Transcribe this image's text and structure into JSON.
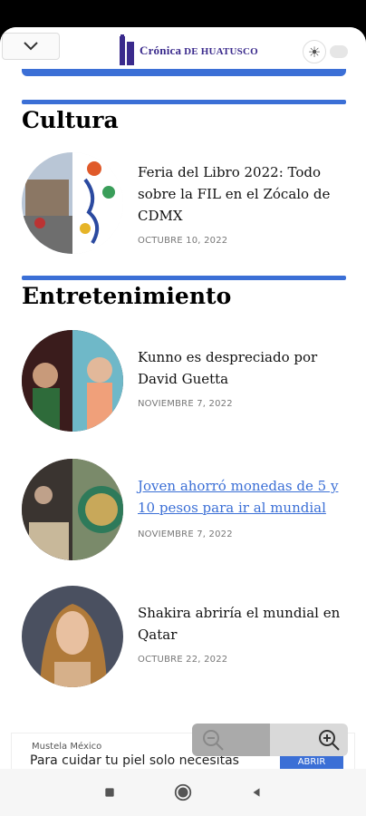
{
  "header": {
    "logo_line1": "Crónica",
    "logo_line2": "de Huatusco",
    "collapse_icon": "chevron-down-icon",
    "theme_icon": "sun-icon"
  },
  "sections": [
    {
      "title": "Cultura",
      "articles": [
        {
          "title": "Feria del Libro 2022: Todo sobre la FIL en el Zócalo de CDMX",
          "date": "OCTUBRE 10, 2022",
          "link": false
        }
      ]
    },
    {
      "title": "Entretenimiento",
      "articles": [
        {
          "title": "Kunno es despreciado por David Guetta",
          "date": "NOVIEMBRE 7, 2022",
          "link": false
        },
        {
          "title": "Joven ahorró monedas de 5 y 10 pesos para ir al mundial",
          "date": "NOVIEMBRE 7, 2022",
          "link": true
        },
        {
          "title": "Shakira abriría el mundial en Qatar",
          "date": "OCTUBRE 22, 2022",
          "link": false
        }
      ]
    }
  ],
  "ad": {
    "brand": "Mustela México",
    "text": "Para cuidar tu piel solo necesitas",
    "button": "ABRIR"
  },
  "colors": {
    "accent": "#3b6fd6",
    "logo": "#3a2a8c"
  }
}
